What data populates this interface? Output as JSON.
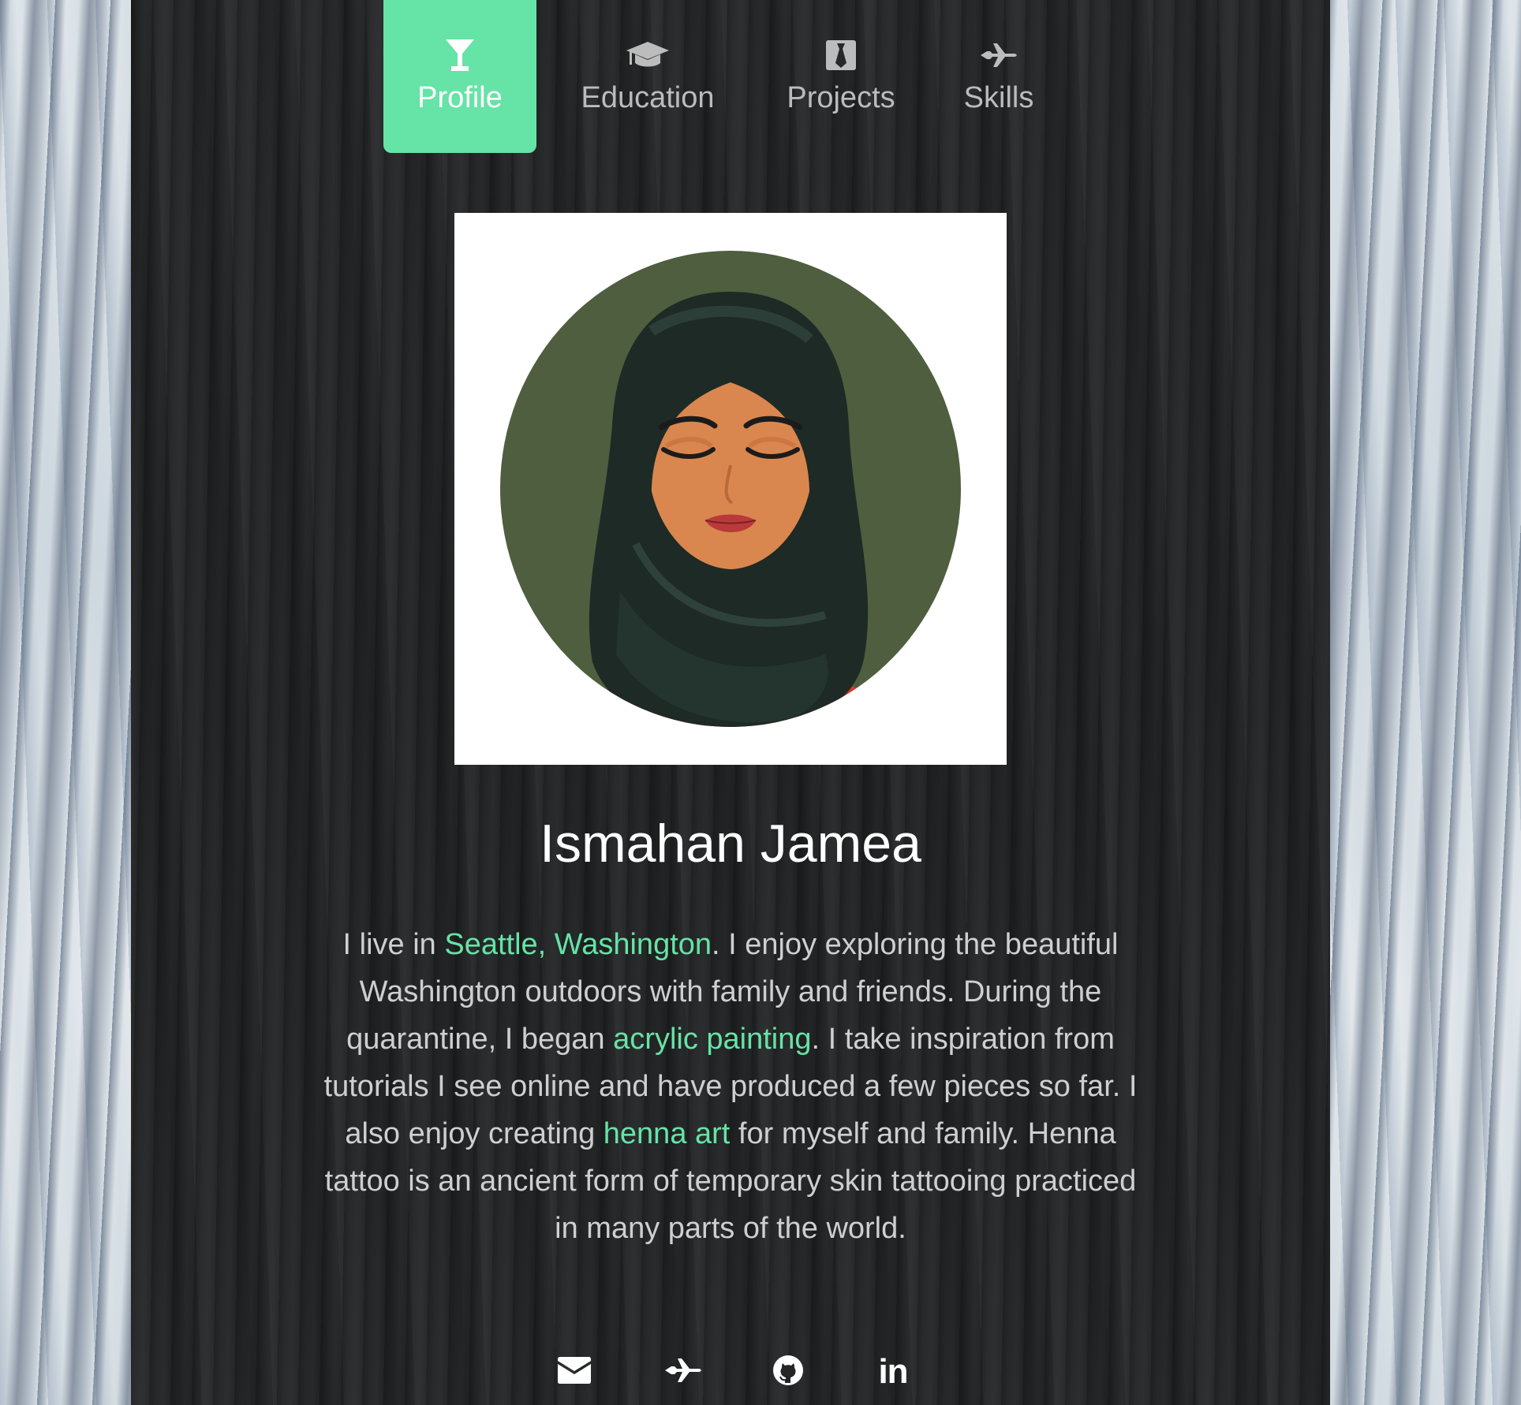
{
  "nav": {
    "tabs": [
      {
        "label": "Profile",
        "icon": "cocktail-glass-icon",
        "active": true
      },
      {
        "label": "Education",
        "icon": "graduation-cap-icon",
        "active": false
      },
      {
        "label": "Projects",
        "icon": "necktie-icon",
        "active": false
      },
      {
        "label": "Skills",
        "icon": "airplane-icon",
        "active": false
      }
    ]
  },
  "profile": {
    "name": "Ismahan Jamea",
    "avatar": "woman-in-hijab-illustration",
    "bio": [
      {
        "text": "I live in ",
        "link": false
      },
      {
        "text": "Seattle, Washington",
        "link": true
      },
      {
        "text": ". I enjoy exploring the beautiful Washington outdoors with family and friends. During the quarantine, I began ",
        "link": false
      },
      {
        "text": "acrylic painting",
        "link": true
      },
      {
        "text": ". I take inspiration from tutorials I see online and have produced a few pieces so far. I also enjoy creating ",
        "link": false
      },
      {
        "text": "henna art",
        "link": true
      },
      {
        "text": " for myself and family. Henna tattoo is an ancient form of temporary skin tattooing practiced in many parts of the world.",
        "link": false
      }
    ]
  },
  "socials": [
    {
      "icon": "envelope-icon"
    },
    {
      "icon": "airplane-icon"
    },
    {
      "icon": "github-icon"
    },
    {
      "icon": "linkedin-icon",
      "text": "in"
    }
  ],
  "colors": {
    "accent": "#66e3a6",
    "panel": "#232526",
    "text": "#cfcfcf",
    "tab_text": "#bcbcbc"
  }
}
